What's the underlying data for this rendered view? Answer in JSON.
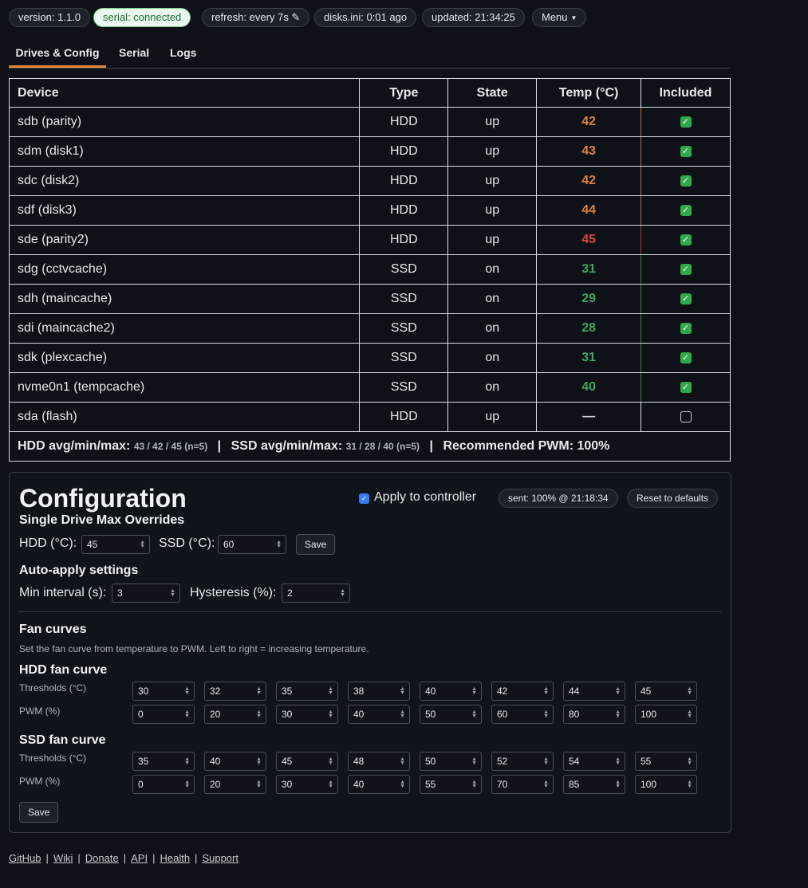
{
  "status_bar": {
    "version": "version: 1.1.0",
    "serial": "serial: connected",
    "refresh": "refresh: every 7s ✎",
    "disks_ini": "disks.ini: 0:01 ago",
    "updated": "updated: 21:34:25",
    "menu": "Menu"
  },
  "tabs": [
    "Drives & Config",
    "Serial",
    "Logs"
  ],
  "table": {
    "headers": [
      "Device",
      "Type",
      "State",
      "Temp (°C)",
      "Included"
    ],
    "rows": [
      {
        "device": "sdb (parity)",
        "type": "HDD",
        "state": "up",
        "temp": "42",
        "level": "orange",
        "included": true
      },
      {
        "device": "sdm (disk1)",
        "type": "HDD",
        "state": "up",
        "temp": "43",
        "level": "orange",
        "included": true
      },
      {
        "device": "sdc (disk2)",
        "type": "HDD",
        "state": "up",
        "temp": "42",
        "level": "orange",
        "included": true
      },
      {
        "device": "sdf (disk3)",
        "type": "HDD",
        "state": "up",
        "temp": "44",
        "level": "orange",
        "included": true
      },
      {
        "device": "sde (parity2)",
        "type": "HDD",
        "state": "up",
        "temp": "45",
        "level": "red",
        "included": true
      },
      {
        "device": "sdg (cctvcache)",
        "type": "SSD",
        "state": "on",
        "temp": "31",
        "level": "green",
        "included": true
      },
      {
        "device": "sdh (maincache)",
        "type": "SSD",
        "state": "on",
        "temp": "29",
        "level": "green",
        "included": true
      },
      {
        "device": "sdi (maincache2)",
        "type": "SSD",
        "state": "on",
        "temp": "28",
        "level": "green",
        "included": true
      },
      {
        "device": "sdk (plexcache)",
        "type": "SSD",
        "state": "on",
        "temp": "31",
        "level": "green",
        "included": true
      },
      {
        "device": "nvme0n1 (tempcache)",
        "type": "SSD",
        "state": "on",
        "temp": "40",
        "level": "green",
        "included": true
      },
      {
        "device": "sda (flash)",
        "type": "HDD",
        "state": "up",
        "temp": "—",
        "level": "none",
        "included": false
      }
    ],
    "summary": {
      "hdd_label": "HDD avg/min/max:",
      "hdd_values": "43 / 42 / 45 (n=5)",
      "ssd_label": "SSD avg/min/max:",
      "ssd_values": "31 / 28 / 40 (n=5)",
      "recommended": "Recommended PWM: 100%",
      "sep": "|"
    }
  },
  "config": {
    "title": "Configuration",
    "apply_label": "Apply to controller",
    "sent": "sent: 100% @ 21:18:34",
    "reset": "Reset to defaults",
    "overrides_heading": "Single Drive Max Overrides",
    "hdd_label": "HDD (°C):",
    "hdd_value": "45",
    "ssd_label": "SSD (°C):",
    "ssd_value": "60",
    "save": "Save",
    "auto_heading": "Auto-apply settings",
    "min_interval_label": "Min interval (s):",
    "min_interval_value": "3",
    "hysteresis_label": "Hysteresis (%):",
    "hysteresis_value": "2",
    "fan_heading": "Fan curves",
    "fan_desc": "Set the fan curve from temperature to PWM. Left to right = increasing temperature.",
    "hdd_curve_heading": "HDD fan curve",
    "ssd_curve_heading": "SSD fan curve",
    "thresholds_label": "Thresholds (°C)",
    "pwm_label": "PWM (%)",
    "hdd_thresholds": [
      "30",
      "32",
      "35",
      "38",
      "40",
      "42",
      "44",
      "45"
    ],
    "hdd_pwm": [
      "0",
      "20",
      "30",
      "40",
      "50",
      "60",
      "80",
      "100"
    ],
    "ssd_thresholds": [
      "35",
      "40",
      "45",
      "48",
      "50",
      "52",
      "54",
      "55"
    ],
    "ssd_pwm": [
      "0",
      "20",
      "30",
      "40",
      "55",
      "70",
      "85",
      "100"
    ],
    "save_curves": "Save"
  },
  "footer": {
    "links": [
      "GitHub",
      "Wiki",
      "Donate",
      "API",
      "Health",
      "Support"
    ],
    "sep": "|"
  },
  "colors": {
    "accent": "#e58a3a",
    "temp_orange": "#e0843a",
    "temp_red": "#e0473a",
    "temp_green": "#3fa55f",
    "check_green": "#2faa4a"
  }
}
